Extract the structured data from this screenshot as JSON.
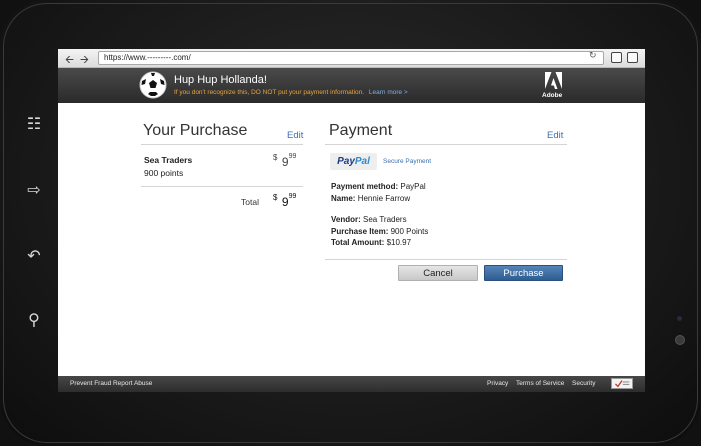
{
  "browser": {
    "url": "https://www.---------.com/"
  },
  "header": {
    "title": "Hup Hup Hollanda!",
    "warning": "If you don't recognize this, DO NOT put your payment information.",
    "learn_more": "Learn more >",
    "brand": "Adobe"
  },
  "purchase": {
    "title": "Your Purchase",
    "edit_label": "Edit",
    "item": {
      "name": "Sea Traders",
      "points": "900 points",
      "price_currency": "$",
      "price_whole": "9",
      "price_cents": "99"
    },
    "total": {
      "label": "Total",
      "currency": "$",
      "whole": "9",
      "cents": "99"
    }
  },
  "payment": {
    "title": "Payment",
    "edit_label": "Edit",
    "provider_pay": "Pay",
    "provider_pal": "Pal",
    "secure_label": "Secure Payment",
    "method_label": "Payment method:",
    "method_value": "PayPal",
    "name_label": "Name:",
    "name_value": "Hennie Farrow",
    "vendor_label": "Vendor:",
    "vendor_value": "Sea Traders",
    "item_label": "Purchase Item:",
    "item_value": "900  Points",
    "amount_label": "Total Amount:",
    "amount_value": "$10.97"
  },
  "actions": {
    "cancel_label": "Cancel",
    "purchase_label": "Purchase"
  },
  "footer": {
    "left_link": "Prevent Fraud Report Abuse",
    "privacy": "Privacy",
    "terms": "Terms of Service",
    "security": "Security"
  },
  "colors": {
    "accent_link": "#3b6fb0",
    "warning": "#e8a33a",
    "purchase_button": "#2f5d92",
    "header_bg": "#333333"
  },
  "icons": {
    "back": "arrow-left-icon",
    "forward": "arrow-right-icon",
    "reload": "reload-icon",
    "logo": "soccer-ball-icon",
    "brand_logo": "adobe-logo-icon"
  }
}
